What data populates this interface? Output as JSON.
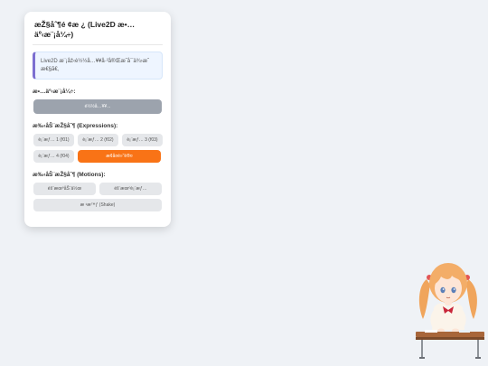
{
  "panel": {
    "title": "æŽ§åˆ¶é  ¢æ  ¿ (Live2D æ•… äº‹æ¨¡å¼÷)",
    "status_text": "Live2D æ¨¡åž‹è½½å…¥¥å·²å®Œæˆå¯ä¾›æˆ æ€§ã€‚",
    "load_section_title": "æ•…äº‹æ¨¡å¼÷:",
    "load_button": "é½½å…¥¥...",
    "expressions_title": "æ‰‹åŠ¨æŽ§åˆ¶ (Expressions):",
    "expressions": [
      {
        "label": "è¡¨æƒ… 1 (f01)",
        "active": false
      },
      {
        "label": "è¡¨æƒ… 2 (f02)",
        "active": false
      },
      {
        "label": "è¡¨æƒ… 3 (f03)",
        "active": false
      },
      {
        "label": "è¡¨æƒ… 4 (f04)",
        "active": false
      },
      {
        "label": "æ¢å¤é»˜è®¤",
        "active": true
      }
    ],
    "motions_title": "æ‰‹åŠ¨æŽ§åˆ¶ (Motions):",
    "motions": [
      {
        "label": "éš¨æœºåŠ¨ä½œ"
      },
      {
        "label": "éš¨æœºè¡¨æƒ…"
      },
      {
        "label": "æ  ¹æ™ƒ (Shake)"
      }
    ]
  },
  "colors": {
    "accent_active": "#f97316",
    "status_border": "#7c6fd0",
    "load_button_bg": "#9ca3ad",
    "page_bg": "#eff2f6"
  },
  "character": {
    "icon": "live2d-schoolgirl-character"
  }
}
